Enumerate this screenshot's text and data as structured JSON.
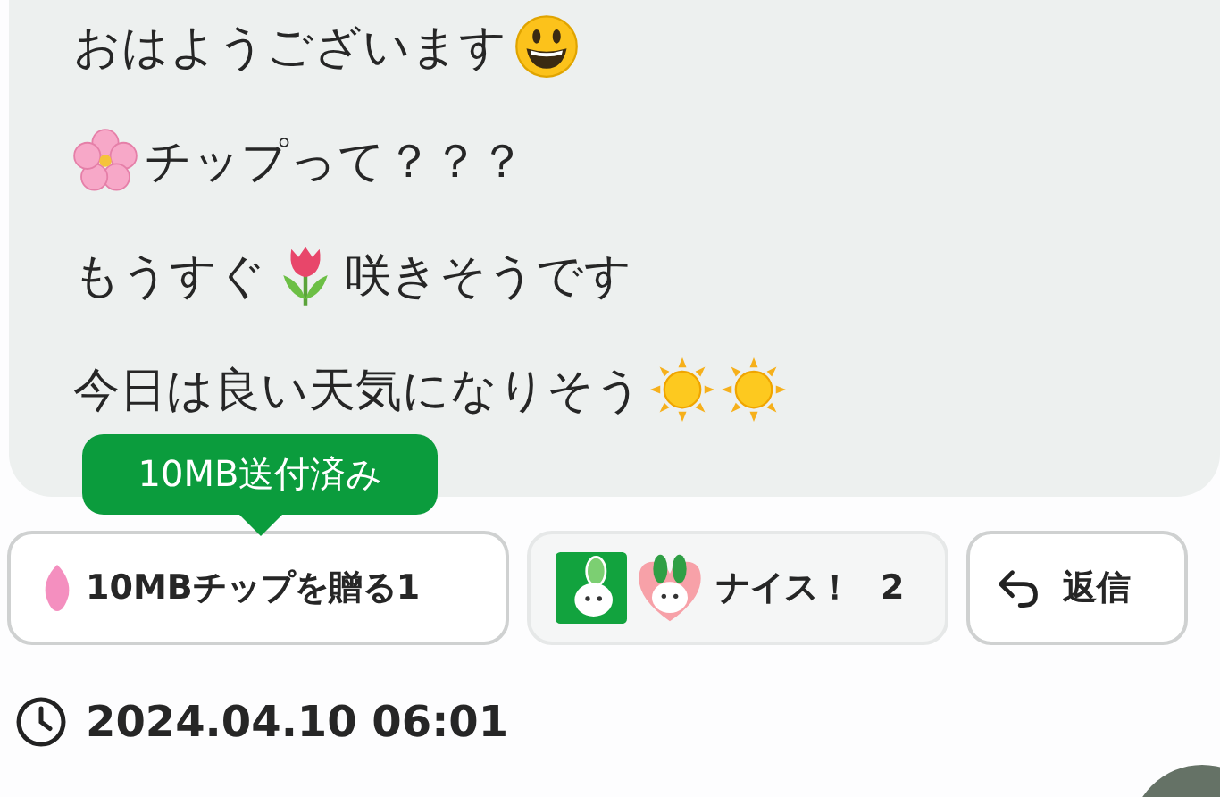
{
  "message": {
    "lines": [
      [
        {
          "kind": "text",
          "text": "おはようございます"
        },
        {
          "kind": "smiley"
        }
      ],
      [
        {
          "kind": "blossom"
        },
        {
          "kind": "text",
          "text": "チップって？？？"
        }
      ],
      [
        {
          "kind": "text",
          "text": "もうすぐ"
        },
        {
          "kind": "tulip"
        },
        {
          "kind": "text",
          "text": "咲きそうです"
        }
      ],
      [
        {
          "kind": "text",
          "text": "今日は良い天気になりそう"
        },
        {
          "kind": "sun"
        },
        {
          "kind": "sun"
        }
      ]
    ]
  },
  "tooltip": {
    "text": "10MB送付済み"
  },
  "actions": {
    "tip_button": {
      "label": "10MBチップを贈る1"
    },
    "nice_button": {
      "label": "ナイス！",
      "count": "2"
    },
    "reply_button": {
      "label": "返信"
    }
  },
  "timestamp": "2024.04.10 06:01"
}
